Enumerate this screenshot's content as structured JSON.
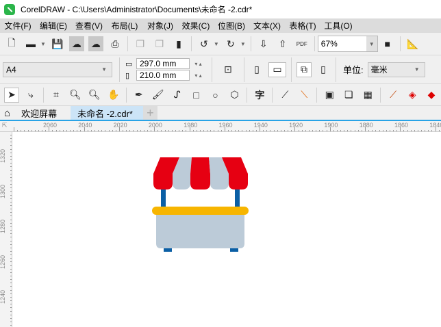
{
  "title": "CorelDRAW - C:\\Users\\Administrator\\Documents\\未命名 -2.cdr*",
  "menu": [
    "文件(F)",
    "编辑(E)",
    "查看(V)",
    "布局(L)",
    "对象(J)",
    "效果(C)",
    "位图(B)",
    "文本(X)",
    "表格(T)",
    "工具(O)"
  ],
  "toolbar": {
    "zoom": "67%",
    "pdf": "PDF"
  },
  "property": {
    "page_size": "A4",
    "width": "297.0 mm",
    "height": "210.0 mm",
    "unit_label": "单位:",
    "unit": "毫米"
  },
  "tabs": {
    "welcome": "欢迎屏幕",
    "doc": "未命名 -2.cdr*",
    "add": "+"
  },
  "ruler_h": [
    "2060",
    "2040",
    "2020",
    "2000",
    "1980",
    "1960",
    "1940",
    "1920",
    "1900",
    "1880",
    "1860",
    "1840"
  ],
  "ruler_v": [
    "1320",
    "1300",
    "1280",
    "1260",
    "1240"
  ],
  "colors": {
    "awning_red": "#e60012",
    "awning_light": "#bccbd8",
    "post": "#0b5fa5",
    "counter": "#f7b500",
    "body": "#bccbd8",
    "tab_accent": "#29a3e6"
  }
}
